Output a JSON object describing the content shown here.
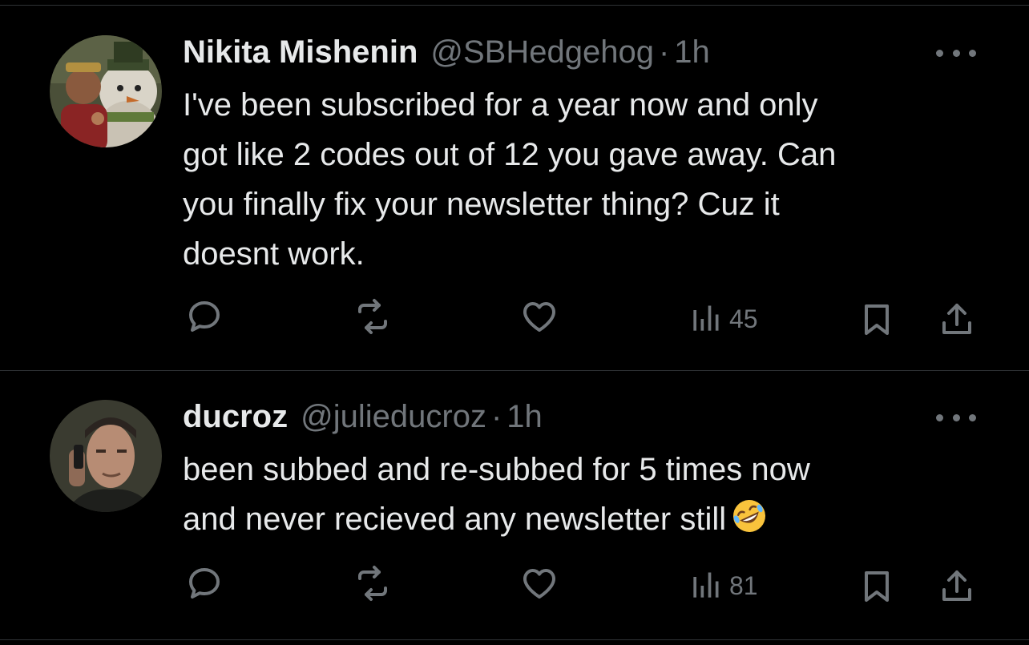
{
  "tweets": [
    {
      "name": "Nikita Mishenin",
      "handle": "@SBHedgehog",
      "separator": "·",
      "time": "1h",
      "text": "I've been subscribed for a year now and only\ngot like 2 codes out of 12 you gave away. Can\nyou finally fix your newsletter thing? Cuz it\ndoesnt work.",
      "views": "45"
    },
    {
      "name": "ducroz",
      "handle": "@julieducroz",
      "separator": "·",
      "time": "1h",
      "text": "been subbed and re-subbed for 5 times now\nand never recieved any newsletter still",
      "views": "81"
    }
  ],
  "icons": {
    "reply": "reply-icon",
    "retweet": "retweet-icon",
    "like": "heart-icon",
    "views": "views-icon",
    "bookmark": "bookmark-icon",
    "share": "share-icon",
    "more": "more-icon",
    "emoji": "rolling-on-floor-laughing-emoji"
  },
  "colors": {
    "background": "#000000",
    "text": "#e7e9ea",
    "secondary": "#71767b",
    "divider": "#2f3336"
  }
}
